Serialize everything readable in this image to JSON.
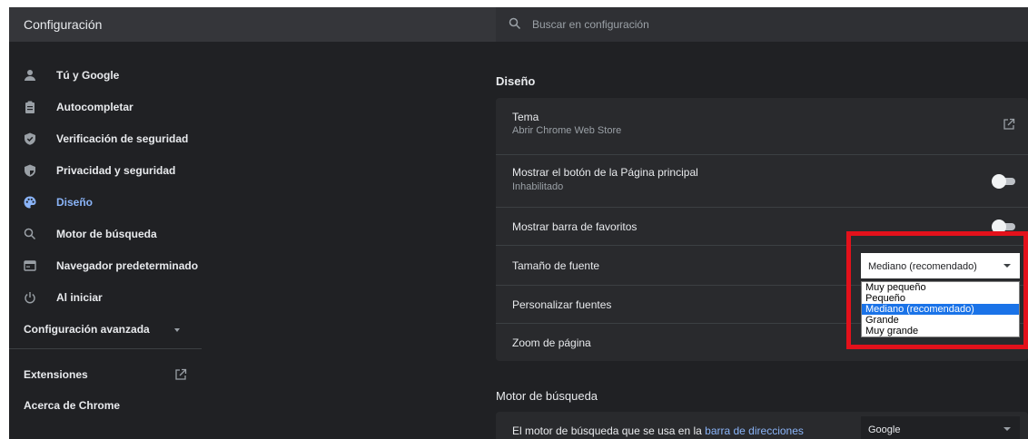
{
  "header": {
    "title": "Configuración"
  },
  "search": {
    "placeholder": "Buscar en configuración"
  },
  "sidebar": {
    "items": [
      {
        "label": "Tú y Google",
        "icon": "person-icon"
      },
      {
        "label": "Autocompletar",
        "icon": "clipboard-icon"
      },
      {
        "label": "Verificación de seguridad",
        "icon": "shield-icon"
      },
      {
        "label": "Privacidad y seguridad",
        "icon": "privacy-shield-icon"
      },
      {
        "label": "Diseño",
        "icon": "palette-icon",
        "active": true
      },
      {
        "label": "Motor de búsqueda",
        "icon": "search-icon"
      },
      {
        "label": "Navegador predeterminado",
        "icon": "browser-icon"
      },
      {
        "label": "Al iniciar",
        "icon": "power-icon"
      }
    ],
    "advanced": "Configuración avanzada",
    "extensions": "Extensiones",
    "about": "Acerca de Chrome"
  },
  "design": {
    "title": "Diseño",
    "theme": {
      "title": "Tema",
      "subtitle": "Abrir Chrome Web Store"
    },
    "home_button": {
      "title": "Mostrar el botón de la Página principal",
      "subtitle": "Inhabilitado",
      "enabled": false
    },
    "bookmarks_bar": {
      "title": "Mostrar barra de favoritos",
      "enabled": false
    },
    "font_size": {
      "title": "Tamaño de fuente",
      "value": "Mediano (recomendado)",
      "options": [
        "Muy pequeño",
        "Pequeño",
        "Mediano (recomendado)",
        "Grande",
        "Muy grande"
      ],
      "selected_index": 2
    },
    "custom_fonts": {
      "title": "Personalizar fuentes"
    },
    "page_zoom": {
      "title": "Zoom de página"
    }
  },
  "search_engine": {
    "title": "Motor de búsqueda",
    "text_prefix": "El motor de búsqueda que se usa en la ",
    "link": "barra de direcciones",
    "value": "Google"
  },
  "colors": {
    "background": "#202124",
    "card": "#292a2d",
    "accent": "#8ab4f8",
    "highlight": "#e3111b",
    "dropdown_selected": "#1a73e8"
  }
}
